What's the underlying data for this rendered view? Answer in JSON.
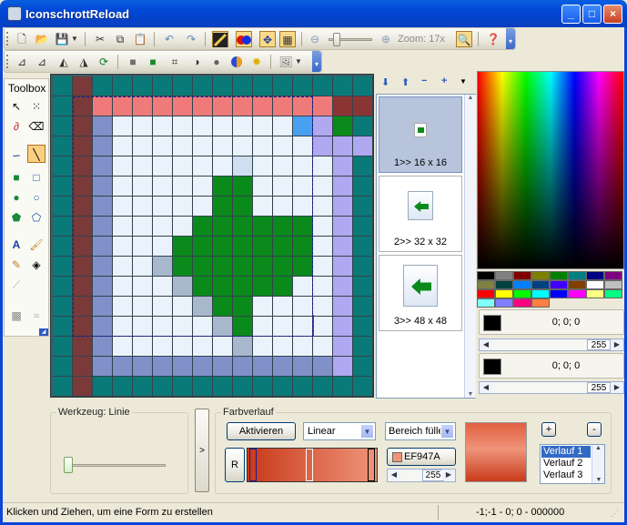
{
  "app": {
    "title": "IconschrottReload"
  },
  "window_buttons": {
    "minimize": "_",
    "maximize": "□",
    "close": "×"
  },
  "toolbar1": {
    "zoom_label": "Zoom: 17x",
    "icons": [
      "new-icon",
      "open-icon",
      "save-icon",
      "cut-icon",
      "copy-icon",
      "paste-icon",
      "undo-icon",
      "redo-icon",
      "line-antialias-icon",
      "color-swap-icon",
      "move-icon",
      "grid-icon",
      "zoom-out-icon",
      "zoom-in-icon",
      "preview-icon",
      "help-icon"
    ]
  },
  "toolbar2": {
    "icons": [
      "flip-h-icon",
      "flip-v-icon",
      "mirror-h-icon",
      "mirror-v-icon",
      "rotate-icon",
      "shadow-icon",
      "outline-icon",
      "crop-icon",
      "contrast-icon",
      "grayscale-icon",
      "color-icon",
      "brightness-icon",
      "image-icon"
    ]
  },
  "toolbox": {
    "label": "Toolbox",
    "tools": [
      "select",
      "magic-select",
      "eraser",
      "lasso",
      "line",
      "rect",
      "filled-rect",
      "ellipse",
      "filled-ellipse",
      "polygon",
      "filled-polygon",
      "text",
      "fill",
      "pencil",
      "bucket",
      "smudge",
      "stamp",
      "drop"
    ],
    "selected": "line"
  },
  "canvas": {
    "grid": [
      "TDTTTTTTTTTTTTTT",
      "TDPPPPPPPPPPPPRR",
      "TDBWWWWWWWWWLVGT",
      "TDBWWWWWWWWWWVVV",
      "TDBWWWWWWXWWWWVT",
      "TDBWWWWWGGWWWWVT",
      "TDBWWWWWGGWWWWVT",
      "TDBWWWWGGGGGGWVT",
      "TDBWWWGGGGGGGWVT",
      "TDBWWKGGGGGGGWVT",
      "TDBWWWKGGGGGWWVT",
      "TDBWWWWKGGWWWWVT",
      "TDBWWWWWKGWWWWVT",
      "TDBWWWWWWKWWWWVT",
      "TDBBBBBBBBBBBBVT",
      "TDTTTTTTTTTTTTTT"
    ]
  },
  "preview": {
    "items": [
      {
        "label": "1>> 16 x 16"
      },
      {
        "label": "2>> 32 x 32"
      },
      {
        "label": "3>> 48 x 48"
      }
    ]
  },
  "colors": {
    "primary": {
      "rgb": "0; 0; 0",
      "alpha": "255"
    },
    "secondary": {
      "rgb": "0; 0; 0",
      "alpha": "255"
    },
    "swatches": [
      "#000000",
      "#808080",
      "#800000",
      "#808000",
      "#008000",
      "#008080",
      "#000080",
      "#800080",
      "#808040",
      "#004040",
      "#0080ff",
      "#004080",
      "#4000ff",
      "#804000",
      "#ffffff",
      "#c0c0c0",
      "#ff0000",
      "#ffff00",
      "#00ff00",
      "#00ffff",
      "#0000ff",
      "#ff00ff",
      "#ffff80",
      "#00ff80",
      "#80ffff",
      "#8080ff",
      "#ff0080",
      "#ff8040"
    ]
  },
  "werkzeug": {
    "title": "Werkzeug: Linie"
  },
  "farbverlauf": {
    "title": "Farbverlauf",
    "activate_label": "Aktivieren",
    "mode": "Linear",
    "area": "Bereich fülle",
    "r_label": "R",
    "hex": "EF947A",
    "alpha": "255",
    "plus": "+",
    "minus": "-",
    "list": [
      "Verlauf 1",
      "Verlauf 2",
      "Verlauf 3"
    ]
  },
  "status": {
    "left": "Klicken und Ziehen, um eine Form zu erstellen",
    "right": "-1;-1 - 0; 0 - 000000"
  }
}
